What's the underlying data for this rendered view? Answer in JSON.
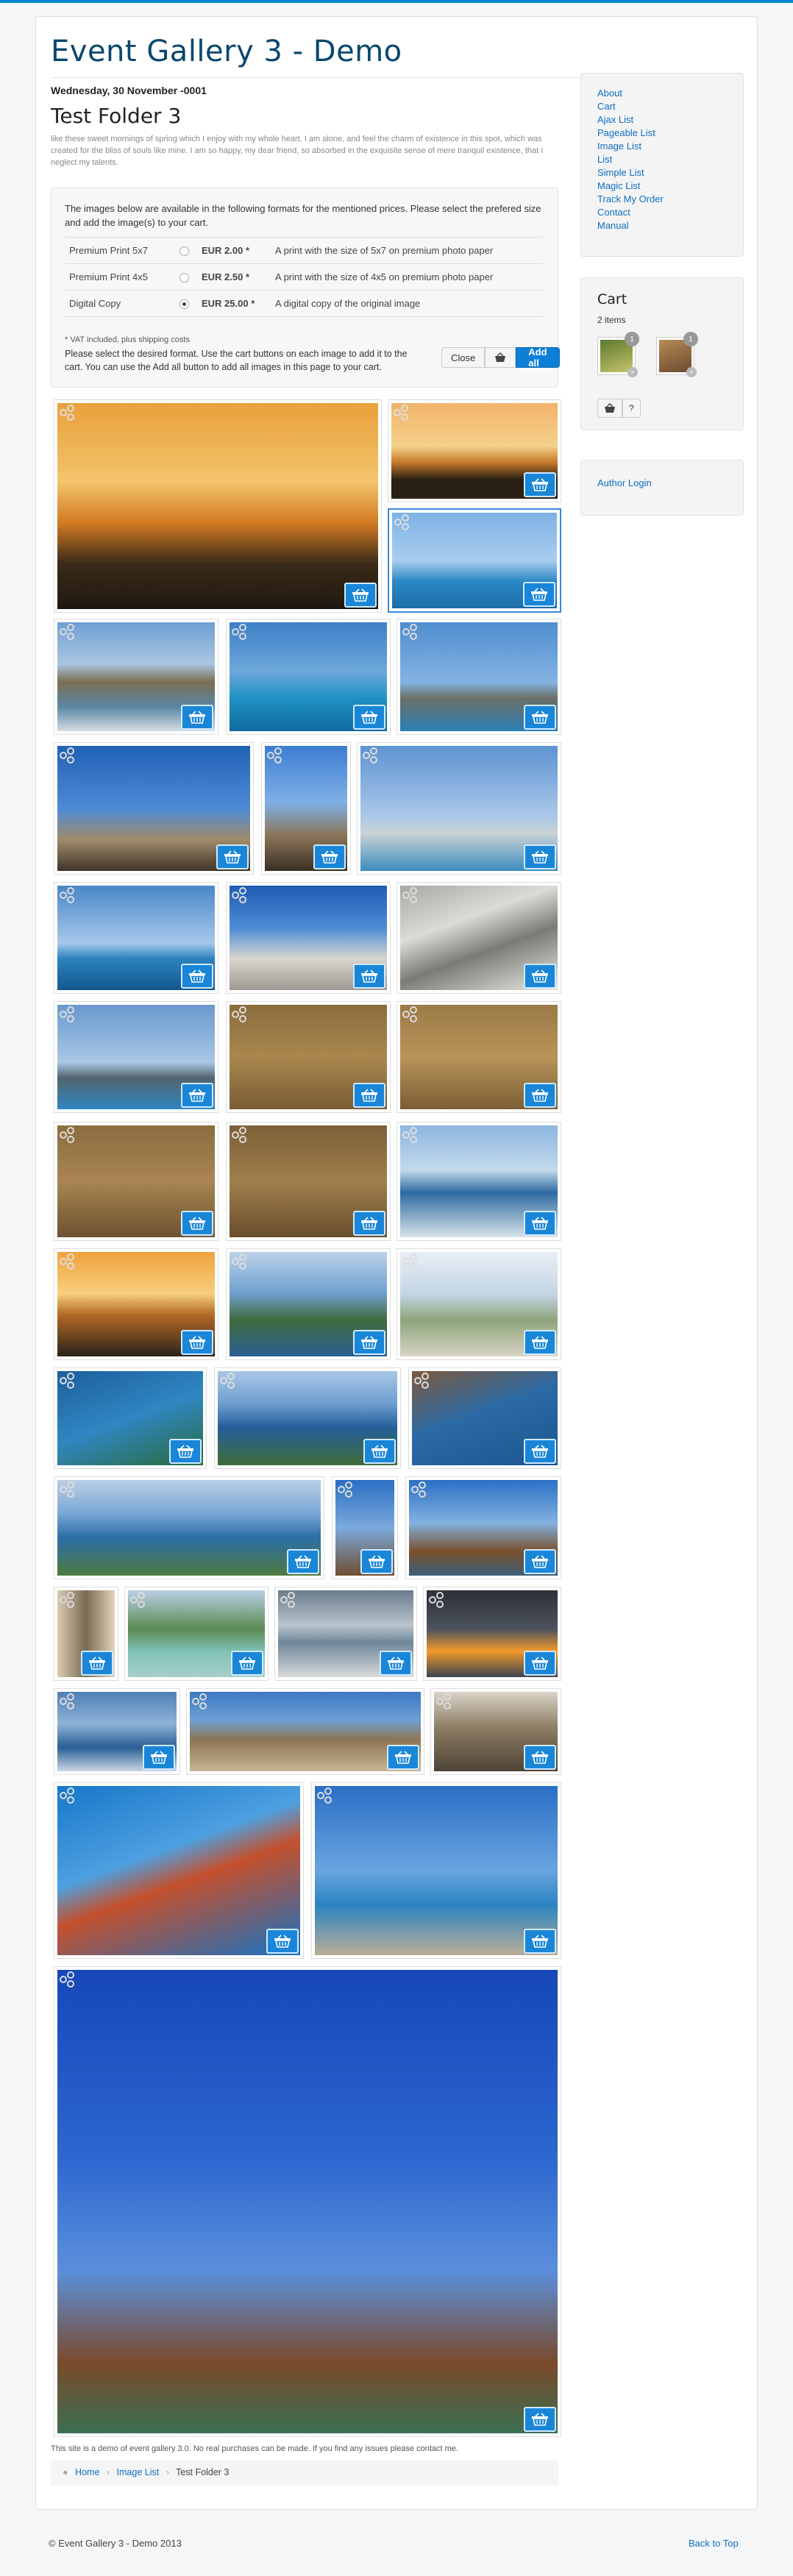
{
  "site": {
    "title": "Event Gallery 3 - Demo"
  },
  "article": {
    "date": "Wednesday, 30 November -0001",
    "title": "Test Folder 3",
    "description": "like these sweet mornings of spring which I enjoy with my whole heart. I am alone, and feel the charm of existence in this spot, which was created for the bliss of souls like mine. I am so happy, my dear friend, so absorbed in the exquisite sense of mere tranquil existence, that I neglect my talents."
  },
  "prices": {
    "intro": "The images below are available in the following formats for the mentioned prices. Please select the prefered size and add the image(s) to your cart.",
    "rows": [
      {
        "name": "Premium Print 5x7",
        "price": "EUR 2.00 *",
        "description": "A print with the size of 5x7 on premium photo paper",
        "selected": false
      },
      {
        "name": "Premium Print 4x5",
        "price": "EUR 2.50 *",
        "description": "A print with the size of 4x5 on premium photo paper",
        "selected": false
      },
      {
        "name": "Digital Copy",
        "price": "EUR 25.00 *",
        "description": "A digital copy of the original image",
        "selected": true
      }
    ],
    "vat_note": "* VAT included, plus shipping costs",
    "select_text": "Please select the desired format. Use the cart buttons on each image to add it to the cart. You can use the Add all button to add all images in this page to your cart.",
    "close_label": "Close",
    "add_all_label": "Add all"
  },
  "gallery": {
    "images": [
      {
        "name": "sunset-sea",
        "bg": "linear-gradient(180deg,#e9a03a 0%,#f3c46c 38%,#d37b22 58%,#3a2a18 78%,#1f1810 100%)"
      },
      {
        "name": "sunset-coast",
        "bg": "linear-gradient(180deg,#f1b36a 0%,#f5d18a 45%,#c57a2a 62%,#2a2016 80%)"
      },
      {
        "name": "blue-sea",
        "bg": "linear-gradient(180deg,#7fb2e6 0%,#a9cdee 50%,#2a87c6 72%,#1c6ea6 100%)"
      },
      {
        "name": "resort-beach",
        "bg": "linear-gradient(180deg,#6f9ed4 0%,#aac6e0 38%,#7b6d52 55%,#5a87a6 78%,#d6dde2 100%)"
      },
      {
        "name": "palm-bay",
        "bg": "linear-gradient(180deg,#3d7fc8 0%,#6ea8db 45%,#1d92c2 70%,#0f6aa0 100%)"
      },
      {
        "name": "harbour-wall",
        "bg": "linear-gradient(180deg,#4f8ecf 0%,#84b3e2 55%,#6c6f66 70%,#2b7fb7 100%)"
      },
      {
        "name": "temple-columns",
        "bg": "linear-gradient(180deg,#2161b5 0%,#4d8bd6 50%,#a08b6a 75%,#40342a 100%)"
      },
      {
        "name": "temple-sun",
        "bg": "linear-gradient(180deg,#3d7dd0 0%,#7fb0e6 45%,#8a7558 72%,#3b3024 100%)"
      },
      {
        "name": "lighthouse",
        "bg": "linear-gradient(180deg,#5d93d2 0%,#a8c7e8 55%,#c9d2d6 70%,#3d8cbf 100%)"
      },
      {
        "name": "boat-sea",
        "bg": "linear-gradient(180deg,#4a86c8 0%,#a6c8ea 55%,#2b83bf 70%,#14588e 100%)"
      },
      {
        "name": "ruins-columns",
        "bg": "linear-gradient(180deg,#1f5cb3 0%,#4c8bd4 40%,#d8d5cf 70%,#9e9a92 100%)"
      },
      {
        "name": "stones",
        "bg": "linear-gradient(160deg,#a8a8a2 0%,#dcdcd7 35%,#7b7b76 60%,#e9e9e4 100%)"
      },
      {
        "name": "coastline",
        "bg": "linear-gradient(180deg,#6a98cf 0%,#a9c8e6 55%,#52646d 70%,#2f86c2 100%)"
      },
      {
        "name": "kid-beach",
        "bg": "linear-gradient(180deg,#8a6c3e 0%,#a9874e 50%,#795c33 100%)"
      },
      {
        "name": "beach-toy",
        "bg": "linear-gradient(180deg,#9b7a45 0%,#b8945a 50%,#7c5e34 100%)"
      },
      {
        "name": "red-shovel",
        "bg": "linear-gradient(180deg,#8c6d40 0%,#a88552 50%,#6e5330 100%)"
      },
      {
        "name": "pink-shovel",
        "bg": "linear-gradient(180deg,#7c6038 0%,#9f7f4c 50%,#684d2b 100%)"
      },
      {
        "name": "waves",
        "bg": "linear-gradient(180deg,#8db6e0 0%,#c3d9ec 40%,#2e6aa0 60%,#d8e3ea 100%)"
      },
      {
        "name": "sunset-water",
        "bg": "linear-gradient(180deg,#f0a23c 0%,#f7cf7e 40%,#b36a25 60%,#2a231c 100%)"
      },
      {
        "name": "cliff-bay",
        "bg": "linear-gradient(180deg,#bcd2ea 0%,#6e9fcd 40%,#3f6b3d 65%,#2a5f94 100%)"
      },
      {
        "name": "city-view",
        "bg": "linear-gradient(180deg,#e9eef3 0%,#c4d6e6 40%,#8ea57b 65%,#d8d3c5 100%)"
      },
      {
        "name": "boat-bay",
        "bg": "linear-gradient(160deg,#1d5f9e 0%,#2f86c1 50%,#2a6b3d 100%)"
      },
      {
        "name": "bay-panorama",
        "bg": "linear-gradient(180deg,#a9c7e6 0%,#6d9ecf 35%,#235e99 60%,#3f6d3a 100%)"
      },
      {
        "name": "rocky-coast",
        "bg": "linear-gradient(160deg,#7d5a3e 0%,#2b6aa5 45%,#1b5690 100%)"
      },
      {
        "name": "harbour-panorama",
        "bg": "linear-gradient(180deg,#b9cfe6 0%,#7aa7d6 35%,#2b6ea8 60%,#4e7a3f 100%)"
      },
      {
        "name": "ship-mast",
        "bg": "linear-gradient(180deg,#2a6fc3 0%,#7aa9dc 50%,#6e4e32 100%)"
      },
      {
        "name": "pirate-ship",
        "bg": "linear-gradient(180deg,#2b70c4 0%,#83b1e0 45%,#7a4f2c 75%,#3a5f78 100%)"
      },
      {
        "name": "alley",
        "bg": "linear-gradient(90deg,#d9cbb0 0%,#7a6a54 50%,#e2d5bb 100%)"
      },
      {
        "name": "pool-palms",
        "bg": "linear-gradient(180deg,#b8cfe4 0%,#5b8a52 45%,#7fc2b7 70%,#a7cfc8 100%)"
      },
      {
        "name": "cloudy-beach",
        "bg": "linear-gradient(180deg,#6a7b8c 0%,#b9c4cd 40%,#6f8798 60%,#d7dadb 100%)"
      },
      {
        "name": "storm-sky",
        "bg": "linear-gradient(180deg,#2c3038 0%,#4d535e 45%,#f39a2a 70%,#3c4452 100%)"
      },
      {
        "name": "blue-coast",
        "bg": "linear-gradient(180deg,#4f7fb6 0%,#8fb2d6 40%,#2a5f96 70%,#c9d6e2 100%)"
      },
      {
        "name": "amphitheatre",
        "bg": "linear-gradient(180deg,#3c78c4 0%,#6e9fd6 35%,#8c7554 60%,#c8b592 100%)"
      },
      {
        "name": "arena-ruins",
        "bg": "linear-gradient(180deg,#d9d4c8 0%,#8d7d64 45%,#4e4336 100%)"
      },
      {
        "name": "red-flowers",
        "bg": "linear-gradient(160deg,#1777c9 0%,#4ea0e0 40%,#c4502d 55%,#1772c2 100%)"
      },
      {
        "name": "pier-sea",
        "bg": "linear-gradient(180deg,#2a6fc5 0%,#6aa4e0 50%,#2a84c2 70%,#b9ad97 100%)"
      },
      {
        "name": "tall-ship",
        "bg": "linear-gradient(180deg,#1747b9 0%,#2c66cf 40%,#5b8fdc 65%,#7a4a2a 85%,#3a6f52 100%)"
      }
    ]
  },
  "cart": {
    "title": "Cart",
    "count_label": "2 items",
    "items": [
      {
        "qty": "1",
        "bg": "linear-gradient(160deg,#5b7a2f,#c7c36a)"
      },
      {
        "qty": "1",
        "bg": "linear-gradient(160deg,#b88a55,#6a4a2e)"
      }
    ],
    "help_label": "?"
  },
  "menu": {
    "items": [
      "About",
      "Cart",
      "Ajax List",
      "Pageable List",
      "Image List",
      "List",
      "Simple List",
      "Magic List",
      "Track My Order",
      "Contact",
      "Manual"
    ]
  },
  "login": {
    "label": "Author Login"
  },
  "footer": {
    "note": "This site is a demo of event gallery 3.0. No real purchases can be made. If you find any issues please contact me.",
    "crumb_home": "Home",
    "crumb_list": "Image List",
    "crumb_current": "Test Folder 3",
    "copyright": "© Event Gallery 3 - Demo 2013",
    "back_to_top": "Back to Top"
  }
}
